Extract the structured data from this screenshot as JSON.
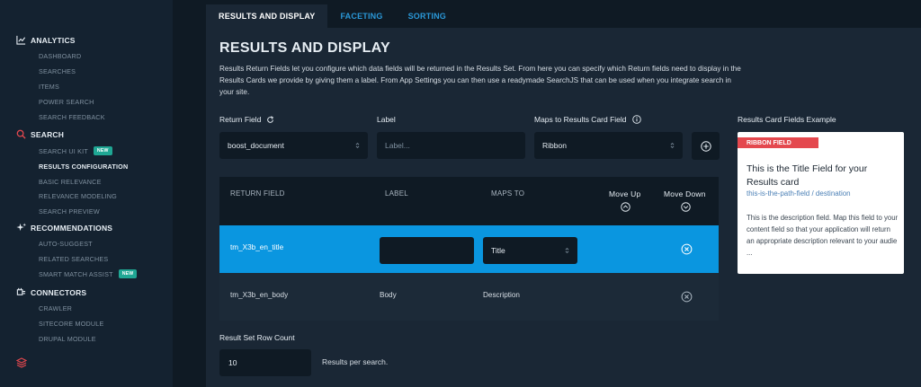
{
  "sidebar": {
    "analytics": {
      "title": "ANALYTICS",
      "items": [
        "DASHBOARD",
        "SEARCHES",
        "ITEMS",
        "POWER SEARCH",
        "SEARCH FEEDBACK"
      ]
    },
    "search": {
      "title": "SEARCH",
      "items": [
        "SEARCH UI KIT",
        "RESULTS CONFIGURATION",
        "BASIC RELEVANCE",
        "RELEVANCE MODELING",
        "SEARCH PREVIEW"
      ],
      "new_badge": "NEW"
    },
    "recommendations": {
      "title": "RECOMMENDATIONS",
      "items": [
        "AUTO-SUGGEST",
        "RELATED SEARCHES",
        "SMART MATCH ASSIST"
      ],
      "new_badge": "NEW"
    },
    "connectors": {
      "title": "CONNECTORS",
      "items": [
        "CRAWLER",
        "SITECORE MODULE",
        "DRUPAL MODULE"
      ]
    }
  },
  "tabs": [
    "RESULTS AND DISPLAY",
    "FACETING",
    "SORTING"
  ],
  "panel": {
    "title": "RESULTS AND DISPLAY",
    "description": "Results Return Fields let you configure which data fields will be returned in the Results Set. From here you can specify which Return fields need to display in the Results Cards we provide by giving them a label. From App Settings you can then use a readymade SearchJS that can be used when you integrate search in your site.",
    "form": {
      "return_field_label": "Return Field",
      "return_field_value": "boost_document",
      "label_label": "Label",
      "label_placeholder": "Label...",
      "maps_to_label": "Maps to Results Card Field",
      "maps_to_value": "Ribbon"
    },
    "card_example": {
      "heading": "Results Card Fields Example",
      "ribbon": "RIBBON FIELD",
      "title": "This is the Title Field for your Results card",
      "path": "this-is-the-path-field / destination",
      "description": "This is the description field. Map this field to your content field so that your application will return an appropriate description relevant to your audie ..."
    },
    "table": {
      "headers": {
        "return_field": "RETURN FIELD",
        "label": "LABEL",
        "maps_to": "MAPS TO",
        "move_up": "Move Up",
        "move_down": "Move Down"
      },
      "rows": [
        {
          "field": "tm_X3b_en_title",
          "label": "",
          "maps_to": "Title"
        },
        {
          "field": "tm_X3b_en_body",
          "label": "Body",
          "maps_to": "Description"
        }
      ]
    },
    "row_count": {
      "label": "Result Set Row Count",
      "value": "10",
      "suffix": "Results per search."
    }
  },
  "colors": {
    "accent": "#0a96e0",
    "tab_link": "#2a98d8",
    "ribbon": "#e4484e",
    "badge": "#1fa794",
    "search_icon": "#e4484e"
  }
}
